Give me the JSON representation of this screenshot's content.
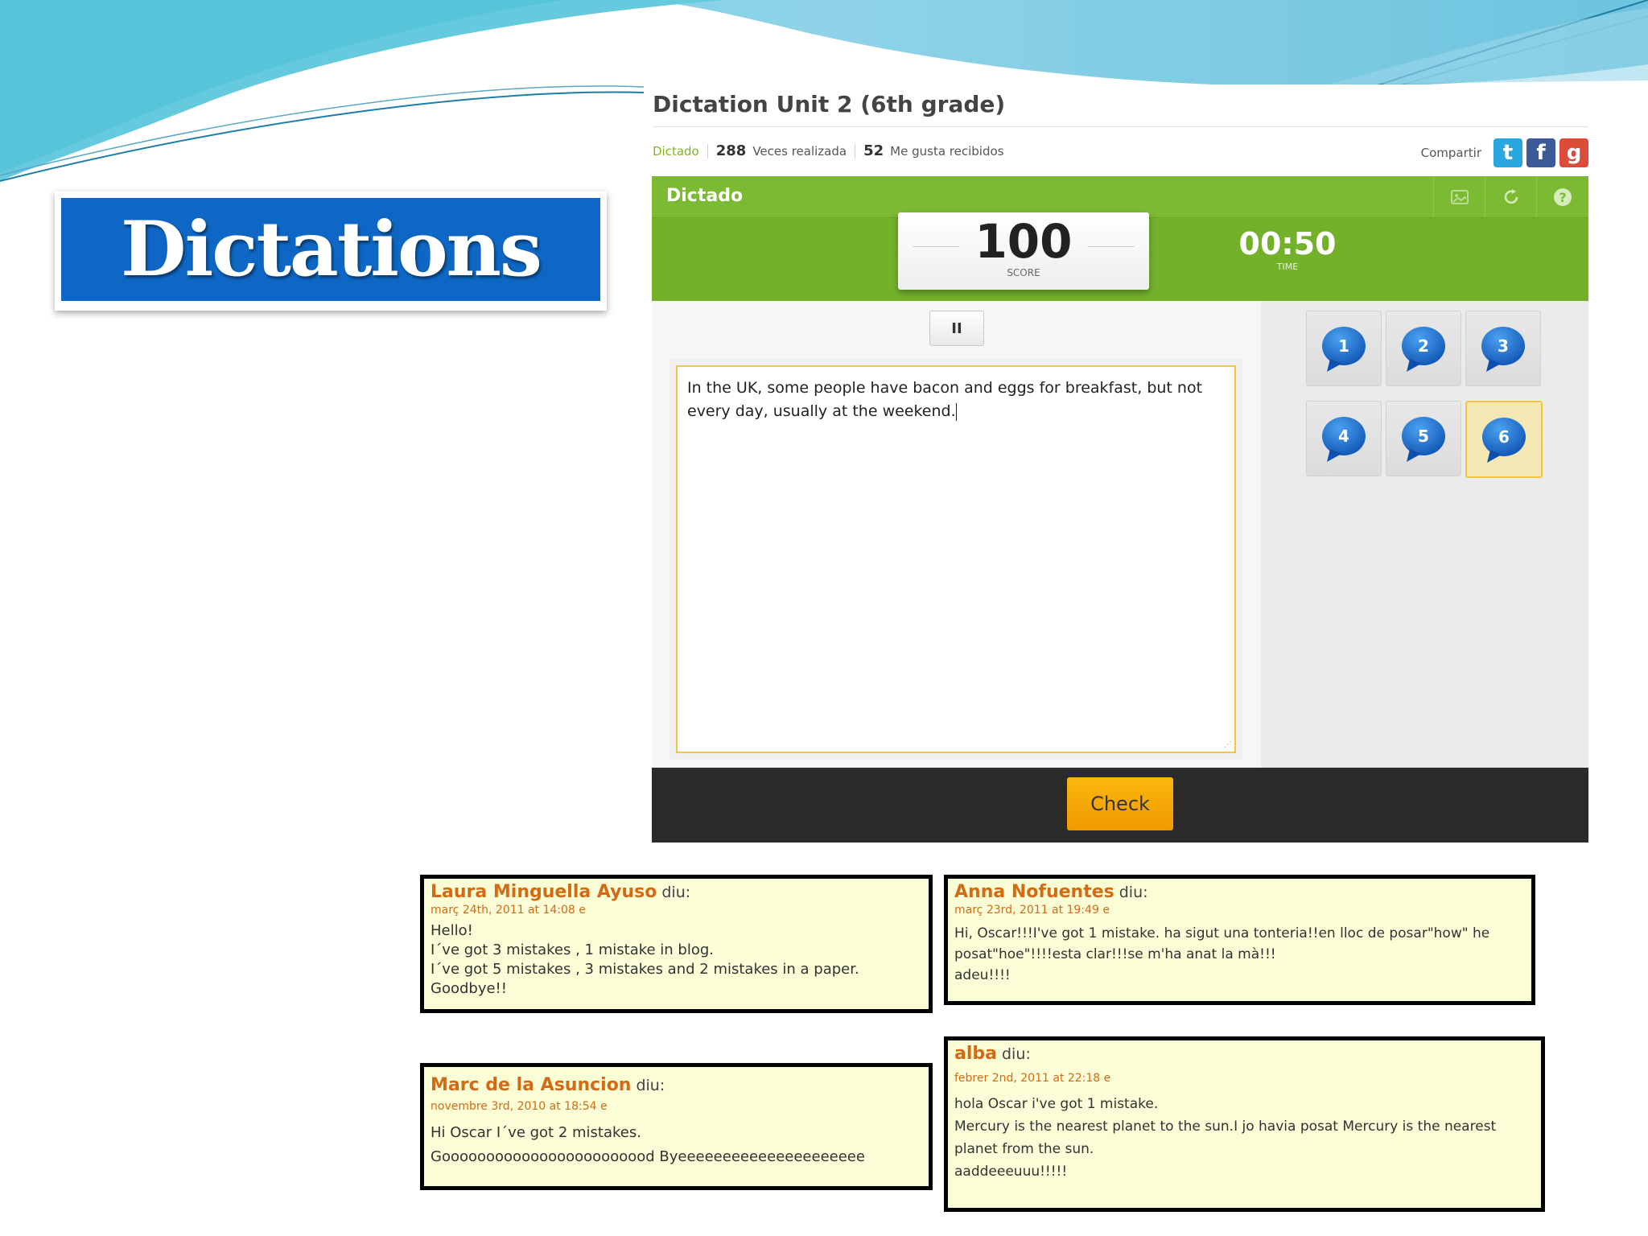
{
  "slide": {
    "title": "Dictations"
  },
  "app": {
    "title": "Dictation Unit 2 (6th grade)",
    "meta": {
      "tag": "Dictado",
      "times_done_count": "288",
      "times_done_label": "Veces realizada",
      "likes_count": "52",
      "likes_label": "Me gusta recibidos"
    },
    "share": {
      "label": "Compartir",
      "twitter_glyph": "t",
      "facebook_glyph": "f",
      "google_glyph": "g"
    },
    "panel": {
      "label": "Dictado",
      "tools": [
        "gallery-icon",
        "refresh-icon",
        "help-icon"
      ]
    },
    "score": {
      "value": "100",
      "label": "SCORE"
    },
    "time": {
      "value": "00:50",
      "label": "TIME"
    },
    "pause_glyph": "II",
    "answer_text": "In the UK, some people have bacon and eggs for breakfast, but not every day, usually at the weekend.",
    "tracks": [
      "1",
      "2",
      "3",
      "4",
      "5",
      "6"
    ],
    "selected_track": "6",
    "check_label": "Check",
    "colors": {
      "green": "#7cba33",
      "check": "#f7a90a",
      "accent": "#f2c542"
    }
  },
  "comments": [
    {
      "author": "Laura Minguella Ayuso",
      "verb": "diu:",
      "date": "març 24th, 2011 at 14:08 e",
      "lines": [
        "Hello!",
        "I´ve got 3 mistakes , 1 mistake in blog.",
        "I´ve got 5 mistakes , 3 mistakes and 2 mistakes in a paper.",
        "Goodbye!!"
      ]
    },
    {
      "author": "Anna Nofuentes",
      "verb": "diu:",
      "date": "març 23rd, 2011 at 19:49 e",
      "lines": [
        "Hi, Oscar!!!I've got 1 mistake. ha sigut una tonteria!!en lloc de posar\"how\" he posat\"hoe\"!!!!esta clar!!!se m'ha anat la mà!!!",
        "adeu!!!!"
      ]
    },
    {
      "author": "Marc de la Asuncion",
      "verb": "diu:",
      "date": "novembre 3rd, 2010 at 18:54 e",
      "lines": [
        "Hi Oscar I´ve got 2 mistakes.",
        "Goooooooooooooooooooooood Byeeeeeeeeeeeeeeeeeeeee"
      ]
    },
    {
      "author": "alba",
      "verb": "diu:",
      "date": "febrer 2nd, 2011 at 22:18 e",
      "lines": [
        "hola Oscar i've got 1 mistake.",
        "Mercury is the nearest planet to the sun.I jo havia posat Mercury is the nearest planet from the sun.",
        "aaddeeeuuu!!!!!"
      ]
    }
  ]
}
